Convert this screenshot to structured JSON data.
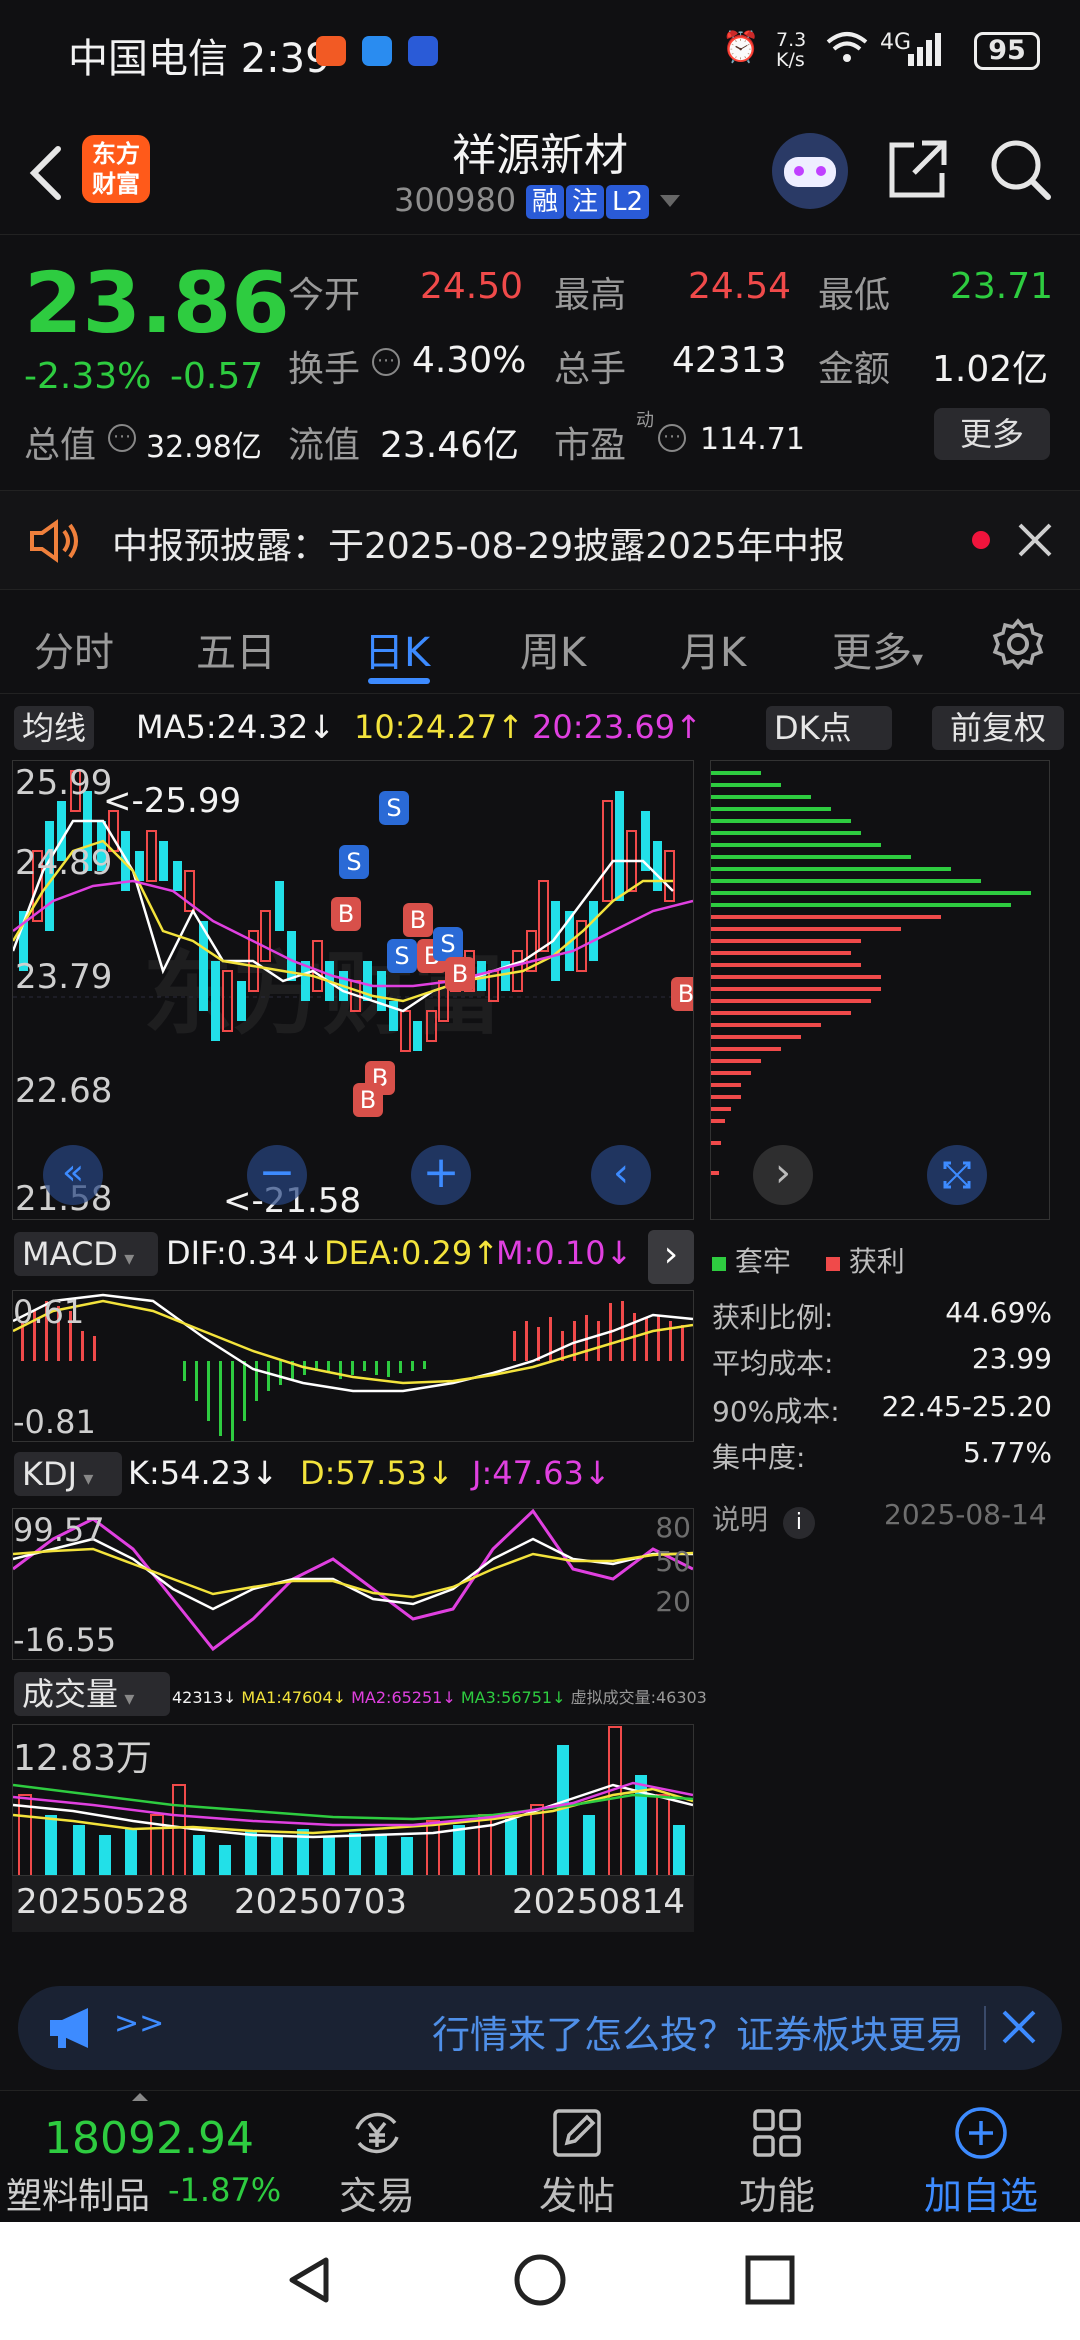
{
  "status": {
    "carrier": "中国电信",
    "time": "2:39",
    "speed_top": "7.3",
    "speed_bottom": "K/s",
    "network": "4G",
    "battery": "95"
  },
  "header": {
    "logo_line1": "东方",
    "logo_line2": "财富",
    "name": "祥源新材",
    "code": "300980",
    "tags": [
      "融",
      "注",
      "L2"
    ]
  },
  "quote": {
    "price": "23.86",
    "change_pct": "-2.33%",
    "change_abs": "-0.57",
    "open_label": "今开",
    "open": "24.50",
    "high_label": "最高",
    "high": "24.54",
    "low_label": "最低",
    "low": "23.71",
    "turnover_label": "换手",
    "turnover": "4.30%",
    "volume_label": "总手",
    "volume": "42313",
    "amount_label": "金额",
    "amount": "1.02亿",
    "mktcap_label": "总值",
    "mktcap": "32.98亿",
    "float_label": "流值",
    "float": "23.46亿",
    "pe_label": "市盈",
    "pe_sup": "动",
    "pe": "114.71",
    "more": "更多"
  },
  "notice": {
    "text": "中报预披露：于2025-08-29披露2025年中报"
  },
  "tabs": [
    "分时",
    "五日",
    "日K",
    "周K",
    "月K",
    "更多"
  ],
  "active_tab": 2,
  "kline": {
    "ma_pill": "均线",
    "ma5": "MA5:24.32↓",
    "ma10": "10:24.27↑",
    "ma20": "20:23.69↑",
    "dk_pill": "DK点",
    "adjust_pill": "前复权",
    "y_labels": [
      "25.99",
      "24.89",
      "23.79",
      "22.68",
      "21.58"
    ],
    "high_mark": "<-25.99",
    "low_mark": "<-21.58",
    "watermark": "东方财富"
  },
  "macd": {
    "pill": "MACD",
    "dif": "DIF:0.34↓",
    "dea": "DEA:0.29↑",
    "m": "M:0.10↓",
    "y_top": "0.61",
    "y_bottom": "-0.81"
  },
  "kdj": {
    "pill": "KDJ",
    "k": "K:54.23↓",
    "d": "D:57.53↓",
    "j": "J:47.63↓",
    "y_top": "99.57",
    "y_bottom": "-16.55",
    "r_labels": [
      "80",
      "50",
      "20"
    ]
  },
  "volume": {
    "pill": "成交量",
    "v": "42313↓",
    "ma1": "MA1:47604↓",
    "ma2": "MA2:65251↓",
    "ma3": "MA3:56751↓",
    "virt": "虚拟成交量:46303",
    "y_top": "12.83万",
    "dates": [
      "20250528",
      "20250703",
      "20250814"
    ]
  },
  "chips": {
    "legend_trap": "套牢",
    "legend_profit": "获利",
    "rows": [
      {
        "label": "获利比例:",
        "value": "44.69%"
      },
      {
        "label": "平均成本:",
        "value": "23.99"
      },
      {
        "label": "90%成本:",
        "value": "22.45-25.20"
      },
      {
        "label": "集中度:",
        "value": "5.77%"
      }
    ],
    "note_label": "说明",
    "date": "2025-08-14"
  },
  "ad": {
    "arrows": ">>",
    "text": "行情来了怎么投？证券板块更易"
  },
  "bottomnav": {
    "index_value": "18092.94",
    "index_name": "塑料制品",
    "index_change": "-1.87%",
    "items": [
      "交易",
      "发帖",
      "功能",
      "加自选"
    ]
  },
  "colors": {
    "up": "#f04a4a",
    "down": "#2ecc40",
    "accent": "#3d8bff",
    "cyan": "#22e0e8",
    "yellow": "#f3e33c",
    "magenta": "#e040e0"
  }
}
